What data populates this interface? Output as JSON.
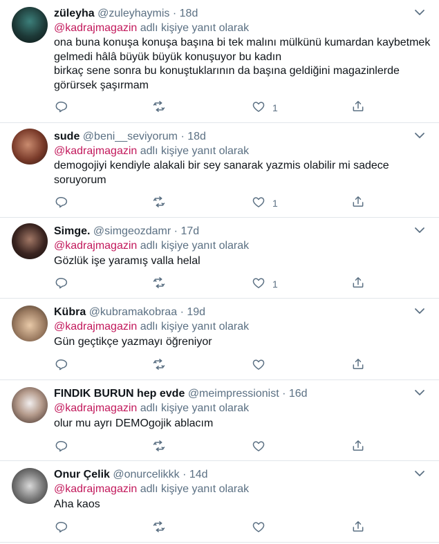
{
  "reply_prefix": "adlı kişiye yanıt olarak",
  "colors": {
    "mention": "#c2185b",
    "muted": "#5b7083",
    "text": "#0f1419",
    "divider": "#e1e6ea"
  },
  "icons": [
    "reply-icon",
    "retweet-icon",
    "like-icon",
    "share-icon",
    "chevron-down-icon"
  ],
  "tweets": [
    {
      "name": "züleyha",
      "handle": "@zuleyhaymis",
      "time": "18d",
      "mention": "@kadrajmagazin",
      "lines": [
        "ona buna konuşa konuşa başına bi tek malını mülkünü kumardan kaybetmek",
        "gelmedi hâlâ büyük büyük konuşuyor bu kadın",
        "birkaç sene sonra bu konuştuklarının da başına geldiğini magazinlerde",
        "görürsek şaşırmam"
      ],
      "likes": "1"
    },
    {
      "name": "sude",
      "handle": "@beni__seviyorum",
      "time": "18d",
      "mention": "@kadrajmagazin",
      "lines": [
        "demogojiyi kendiyle alakali bir sey sanarak yazmis olabilir mi sadece",
        "soruyorum"
      ],
      "likes": "1"
    },
    {
      "name": "Simge.",
      "handle": "@simgeozdamr",
      "time": "17d",
      "mention": "@kadrajmagazin",
      "lines": [
        "Gözlük işe yaramış valla helal"
      ],
      "likes": "1"
    },
    {
      "name": "Kübra",
      "handle": "@kubramakobraa",
      "time": "19d",
      "mention": "@kadrajmagazin",
      "lines": [
        "Gün geçtikçe yazmayı öğreniyor"
      ],
      "likes": ""
    },
    {
      "name": "FINDIK BURUN hep evde",
      "handle": "@meimpressionist",
      "time": "16d",
      "mention": "@kadrajmagazin",
      "lines": [
        "olur mu ayrı DEMOgojik ablacım"
      ],
      "likes": ""
    },
    {
      "name": "Onur Çelik",
      "handle": "@onurcelikkk",
      "time": "14d",
      "mention": "@kadrajmagazin",
      "lines": [
        "Aha kaos"
      ],
      "likes": ""
    }
  ]
}
